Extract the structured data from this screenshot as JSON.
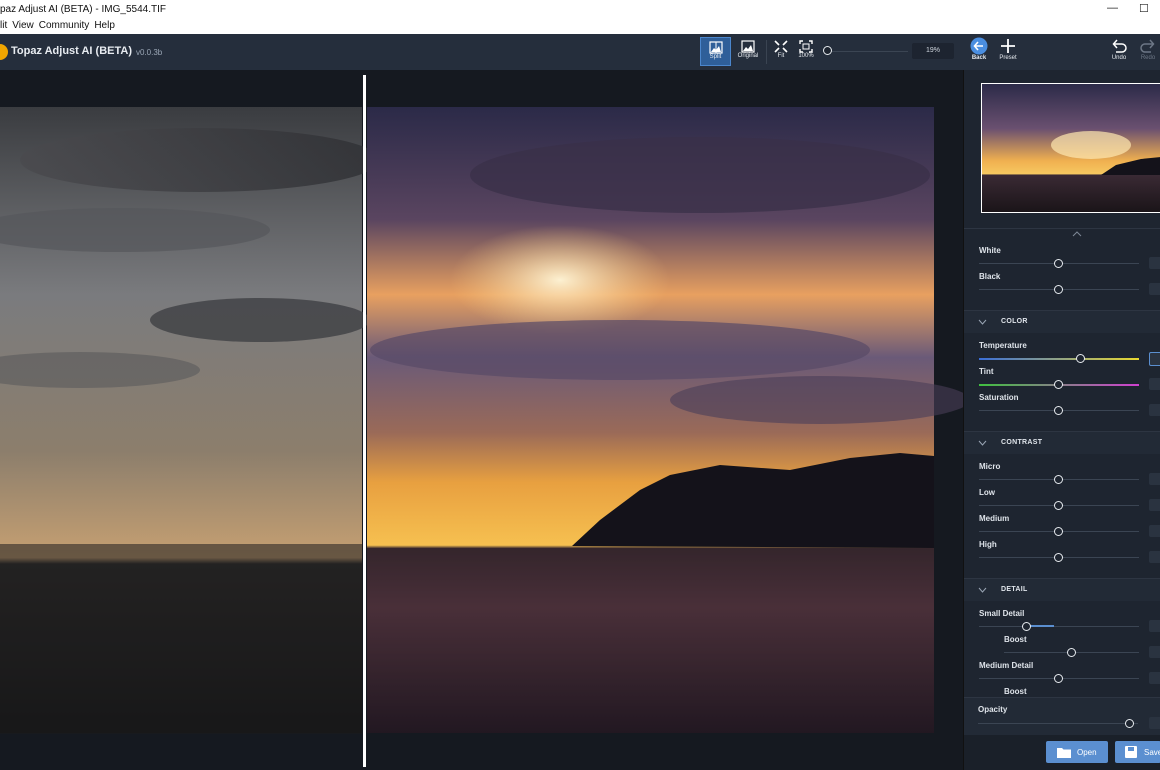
{
  "window": {
    "title": "paz Adjust AI (BETA) - IMG_5544.TIF",
    "min_glyph": "—",
    "max_glyph": "☐"
  },
  "menu": [
    "lit",
    "View",
    "Community",
    "Help"
  ],
  "app": {
    "name": "Topaz Adjust AI (BETA)",
    "version": "v0.0.3b"
  },
  "toolbar": {
    "split_label": "Split",
    "original_label": "Original",
    "fit_label": "Fit",
    "hundred_label": "100%",
    "zoom_value": "19%",
    "back_label": "Back",
    "preset_label": "Preset",
    "undo_label": "Undo",
    "redo_label": "Redo"
  },
  "tone": {
    "white_label": "White",
    "white_value": 0.5,
    "black_label": "Black",
    "black_value": 0.5
  },
  "color": {
    "header": "COLOR",
    "temperature_label": "Temperature",
    "temperature_value": 0.64,
    "tint_label": "Tint",
    "tint_value": 0.5,
    "saturation_label": "Saturation",
    "saturation_value": 0.5
  },
  "contrast": {
    "header": "CONTRAST",
    "micro_label": "Micro",
    "micro_value": 0.5,
    "low_label": "Low",
    "low_value": 0.5,
    "medium_label": "Medium",
    "medium_value": 0.5,
    "high_label": "High",
    "high_value": 0.5
  },
  "detail": {
    "header": "DETAIL",
    "small_label": "Small Detail",
    "small_value": 0.3,
    "boost1_label": "Boost",
    "boost1_value": 0.58,
    "medium_label": "Medium Detail",
    "medium_value": 0.5,
    "boost2_label": "Boost"
  },
  "opacity": {
    "label": "Opacity",
    "value": 0.95
  },
  "footer": {
    "open_label": "Open",
    "save_label": "Save"
  },
  "colors": {
    "accent": "#5b8fd0",
    "active": "#2f5f99",
    "logo": "#f0a500"
  }
}
